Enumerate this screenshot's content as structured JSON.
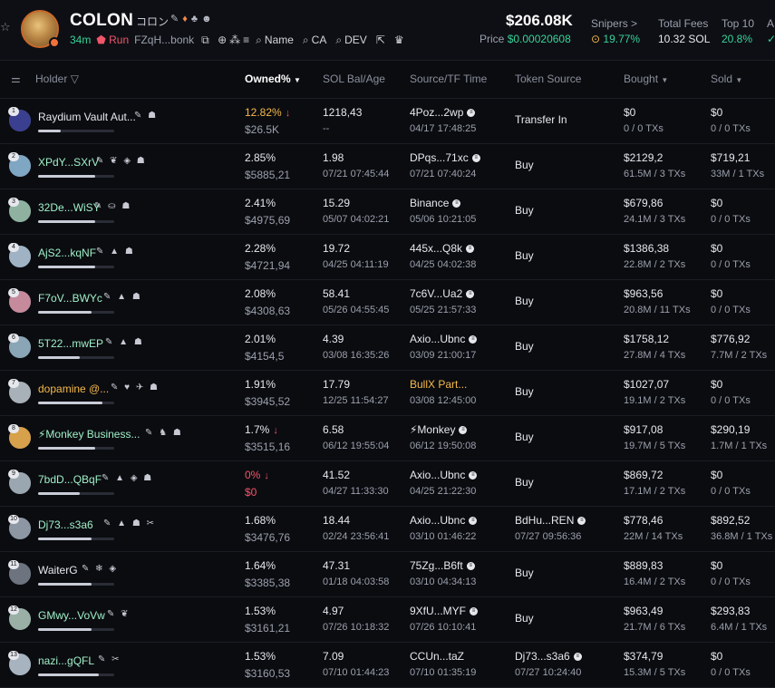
{
  "token": {
    "name": "COLON",
    "subtitle": "コロン",
    "age": "34m",
    "run_label": "Run",
    "address": "FZqH...bonk",
    "links": {
      "name": "Name",
      "ca": "CA",
      "dev": "DEV"
    },
    "price_usd": "$206.08K",
    "price_label": "Price",
    "price_value": "$0.00020608"
  },
  "stats": [
    {
      "label": "Snipers >",
      "value": "19.77%"
    },
    {
      "label": "Total Fees",
      "value": "10.32 SOL"
    },
    {
      "label": "Top 10",
      "value": "20.8%"
    },
    {
      "label": "A",
      "value": ""
    }
  ],
  "columns": {
    "holder": "Holder",
    "owned": "Owned%",
    "sol": "SOL Bal/Age",
    "source_time": "Source/TF Time",
    "token_source": "Token Source",
    "bought": "Bought",
    "sold": "Sold"
  },
  "rows": [
    {
      "rank": "1",
      "name": "Raydium Vault Aut...",
      "owned": "12.82%",
      "usd": "$26.5K",
      "sol": "1218,43",
      "age": "--",
      "src": "4Poz...2wp",
      "src_time": "04/17 17:48:25",
      "ts": "Transfer In",
      "ts_time": "",
      "bought": "$0",
      "bought_tx": "0 / 0 TXs",
      "sold": "$0",
      "sold_tx": "0 / 0 TXs"
    },
    {
      "rank": "2",
      "name": "XPdY...SXrV",
      "owned": "2.85%",
      "usd": "$5885,21",
      "sol": "1.98",
      "age": "07/21 07:45:44",
      "src": "DPqs...71xc",
      "src_time": "07/21 07:40:24",
      "ts": "Buy",
      "ts_time": "",
      "bought": "$2129,2",
      "bought_tx": "61.5M / 3 TXs",
      "sold": "$719,21",
      "sold_tx": "33M / 1 TXs"
    },
    {
      "rank": "3",
      "name": "32De...WiSY",
      "owned": "2.41%",
      "usd": "$4975,69",
      "sol": "15.29",
      "age": "05/07 04:02:21",
      "src": "Binance",
      "src_time": "05/06 10:21:05",
      "ts": "Buy",
      "ts_time": "",
      "bought": "$679,86",
      "bought_tx": "24.1M / 3 TXs",
      "sold": "$0",
      "sold_tx": "0 / 0 TXs"
    },
    {
      "rank": "4",
      "name": "AjS2...kqNF",
      "owned": "2.28%",
      "usd": "$4721,94",
      "sol": "19.72",
      "age": "04/25 04:11:19",
      "src": "445x...Q8k",
      "src_time": "04/25 04:02:38",
      "ts": "Buy",
      "ts_time": "",
      "bought": "$1386,38",
      "bought_tx": "22.8M / 2 TXs",
      "sold": "$0",
      "sold_tx": "0 / 0 TXs"
    },
    {
      "rank": "5",
      "name": "F7oV...BWYc",
      "owned": "2.08%",
      "usd": "$4308,63",
      "sol": "58.41",
      "age": "05/26 04:55:45",
      "src": "7c6V...Ua2",
      "src_time": "05/25 21:57:33",
      "ts": "Buy",
      "ts_time": "",
      "bought": "$963,56",
      "bought_tx": "20.8M / 11 TXs",
      "sold": "$0",
      "sold_tx": "0 / 0 TXs"
    },
    {
      "rank": "6",
      "name": "5T22...mwEP",
      "owned": "2.01%",
      "usd": "$4154,5",
      "sol": "4.39",
      "age": "03/08 16:35:26",
      "src": "Axio...Ubnc",
      "src_time": "03/09 21:00:17",
      "ts": "Buy",
      "ts_time": "",
      "bought": "$1758,12",
      "bought_tx": "27.8M / 4 TXs",
      "sold": "$776,92",
      "sold_tx": "7.7M / 2 TXs"
    },
    {
      "rank": "7",
      "name": "dopamine @...",
      "owned": "1.91%",
      "usd": "$3945,52",
      "sol": "17.79",
      "age": "12/25 11:54:27",
      "src": "BullX Part...",
      "src_time": "03/08 12:45:00",
      "ts": "Buy",
      "ts_time": "",
      "bought": "$1027,07",
      "bought_tx": "19.1M / 2 TXs",
      "sold": "$0",
      "sold_tx": "0 / 0 TXs"
    },
    {
      "rank": "8",
      "name": "⚡Monkey Business...",
      "owned": "1.7%",
      "usd": "$3515,16",
      "sol": "6.58",
      "age": "06/12 19:55:04",
      "src": "⚡Monkey",
      "src_time": "06/12 19:50:08",
      "ts": "Buy",
      "ts_time": "",
      "bought": "$917,08",
      "bought_tx": "19.7M / 5 TXs",
      "sold": "$290,19",
      "sold_tx": "1.7M / 1 TXs"
    },
    {
      "rank": "9",
      "name": "7bdD...QBqF",
      "owned": "0%",
      "usd": "$0",
      "sol": "41.52",
      "age": "04/27 11:33:30",
      "src": "Axio...Ubnc",
      "src_time": "04/25 21:22:30",
      "ts": "Buy",
      "ts_time": "",
      "bought": "$869,72",
      "bought_tx": "17.1M / 2 TXs",
      "sold": "$0",
      "sold_tx": "0 / 0 TXs"
    },
    {
      "rank": "10",
      "name": "Dj73...s3a6",
      "owned": "1.68%",
      "usd": "$3476,76",
      "sol": "18.44",
      "age": "02/24 23:56:41",
      "src": "Axio...Ubnc",
      "src_time": "03/10 01:46:22",
      "ts": "BdHu...REN",
      "ts_time": "07/27 09:56:36",
      "bought": "$778,46",
      "bought_tx": "22M / 14 TXs",
      "sold": "$892,52",
      "sold_tx": "36.8M / 1 TXs"
    },
    {
      "rank": "11",
      "name": "WaiterG",
      "owned": "1.64%",
      "usd": "$3385,38",
      "sol": "47.31",
      "age": "01/18 04:03:58",
      "src": "75Zg...B6ft",
      "src_time": "03/10 04:34:13",
      "ts": "Buy",
      "ts_time": "",
      "bought": "$889,83",
      "bought_tx": "16.4M / 2 TXs",
      "sold": "$0",
      "sold_tx": "0 / 0 TXs"
    },
    {
      "rank": "12",
      "name": "GMwy...VoVw",
      "owned": "1.53%",
      "usd": "$3161,21",
      "sol": "4.97",
      "age": "07/26 10:18:32",
      "src": "9XfU...MYF",
      "src_time": "07/26 10:10:41",
      "ts": "Buy",
      "ts_time": "",
      "bought": "$963,49",
      "bought_tx": "21.7M / 6 TXs",
      "sold": "$293,83",
      "sold_tx": "6.4M / 1 TXs"
    },
    {
      "rank": "13",
      "name": "nazi...gQFL",
      "owned": "1.53%",
      "usd": "$3160,53",
      "sol": "7.09",
      "age": "07/10 01:44:23",
      "src": "CCUn...taZ",
      "src_time": "07/10 01:35:19",
      "ts": "Dj73...s3a6",
      "ts_time": "07/27 10:24:40",
      "bought": "$374,79",
      "bought_tx": "15.3M / 5 TXs",
      "sold": "$0",
      "sold_tx": "0 / 0 TXs"
    }
  ],
  "colors": {
    "accent_green": "#36d399",
    "red": "#f0556a",
    "gold": "#f5b94b",
    "background": "#0b0c10"
  }
}
